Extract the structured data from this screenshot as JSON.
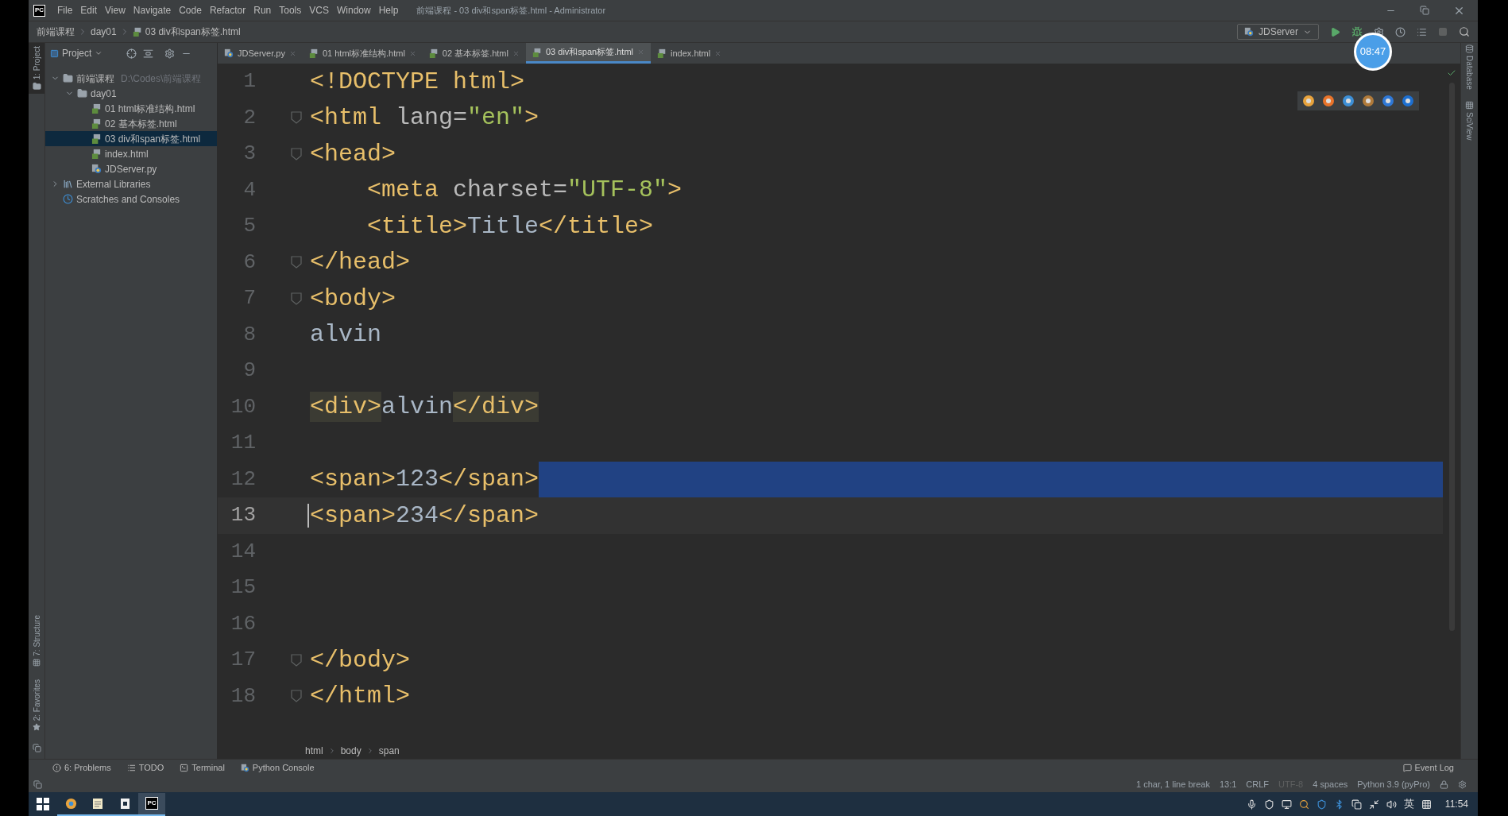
{
  "window": {
    "app_icon": "PC",
    "menu": [
      "File",
      "Edit",
      "View",
      "Navigate",
      "Code",
      "Refactor",
      "Run",
      "Tools",
      "VCS",
      "Window",
      "Help"
    ],
    "title": "前端课程 - 03 div和span标签.html - Administrator"
  },
  "breadcrumb": [
    "前端课程",
    "day01",
    "03 div和span标签.html"
  ],
  "run_config": {
    "label": "JDServer"
  },
  "timer_badge": "08:47",
  "left_strip": {
    "top": [
      "1: Project"
    ],
    "bottom": [
      "7: Structure",
      "2: Favorites"
    ]
  },
  "right_strip": [
    "Database",
    "SciView"
  ],
  "project_panel": {
    "title": "Project",
    "tree": [
      {
        "label": "前端课程",
        "path": "D:\\Codes\\前端课程",
        "kind": "folder",
        "expanded": true,
        "selected": false,
        "children": [
          {
            "label": "day01",
            "kind": "folder",
            "expanded": true,
            "selected": false,
            "children": [
              {
                "label": "01 html标准结构.html",
                "kind": "html",
                "selected": false
              },
              {
                "label": "02 基本标签.html",
                "kind": "html",
                "selected": false
              },
              {
                "label": "03 div和span标签.html",
                "kind": "html",
                "selected": true
              },
              {
                "label": "index.html",
                "kind": "html",
                "selected": false
              },
              {
                "label": "JDServer.py",
                "kind": "python",
                "selected": false
              }
            ]
          }
        ]
      },
      {
        "label": "External Libraries",
        "kind": "library",
        "expanded": false,
        "selected": false
      },
      {
        "label": "Scratches and Consoles",
        "kind": "scratches",
        "selected": false
      }
    ]
  },
  "tabs": [
    {
      "label": "JDServer.py",
      "kind": "python",
      "selected": false
    },
    {
      "label": "01 html标准结构.html",
      "kind": "html",
      "selected": false
    },
    {
      "label": "02 基本标签.html",
      "kind": "html",
      "selected": false
    },
    {
      "label": "03 div和span标签.html",
      "kind": "html",
      "selected": true
    },
    {
      "label": "index.html",
      "kind": "html",
      "selected": false
    }
  ],
  "editor": {
    "lines": [
      {
        "number": "1",
        "fold": false,
        "indented": false,
        "current": false,
        "selected": false,
        "tokens": [
          {
            "kind": "tag",
            "text": "<!DOCTYPE html>"
          }
        ]
      },
      {
        "number": "2",
        "fold": true,
        "indented": false,
        "current": false,
        "selected": false,
        "tokens": [
          {
            "kind": "tag",
            "text": "<html"
          },
          {
            "kind": "attr",
            "text": " lang="
          },
          {
            "kind": "value",
            "text": "\"en\""
          },
          {
            "kind": "tag",
            "text": ">"
          }
        ]
      },
      {
        "number": "3",
        "fold": true,
        "indented": false,
        "current": false,
        "selected": false,
        "tokens": [
          {
            "kind": "tag",
            "text": "<head>"
          }
        ]
      },
      {
        "number": "4",
        "fold": false,
        "indented": true,
        "current": false,
        "selected": false,
        "tokens": [
          {
            "kind": "tag",
            "text": "<meta"
          },
          {
            "kind": "attr",
            "text": " charset="
          },
          {
            "kind": "value",
            "text": "\"UTF-8\""
          },
          {
            "kind": "tag",
            "text": ">"
          }
        ]
      },
      {
        "number": "5",
        "fold": false,
        "indented": true,
        "current": false,
        "selected": false,
        "tokens": [
          {
            "kind": "tag",
            "text": "<title>"
          },
          {
            "kind": "text",
            "text": "Title"
          },
          {
            "kind": "tag",
            "text": "</title>"
          }
        ]
      },
      {
        "number": "6",
        "fold": true,
        "indented": false,
        "current": false,
        "selected": false,
        "tokens": [
          {
            "kind": "tag",
            "text": "</head>"
          }
        ]
      },
      {
        "number": "7",
        "fold": true,
        "indented": false,
        "current": false,
        "selected": false,
        "tokens": [
          {
            "kind": "tag",
            "text": "<body>"
          }
        ]
      },
      {
        "number": "8",
        "fold": false,
        "indented": false,
        "current": false,
        "selected": false,
        "tokens": [
          {
            "kind": "text",
            "text": "alvin"
          }
        ]
      },
      {
        "number": "9",
        "fold": false,
        "indented": false,
        "current": false,
        "selected": false
      },
      {
        "number": "10",
        "fold": false,
        "indented": false,
        "current": false,
        "selected": false,
        "tokens": [
          {
            "kind": "tag",
            "text": "<div>",
            "highlight": true
          },
          {
            "kind": "text",
            "text": "alvin",
            "highlight": false
          },
          {
            "kind": "tag",
            "text": "</div>",
            "highlight": true
          }
        ]
      },
      {
        "number": "11",
        "fold": false,
        "indented": false,
        "current": false,
        "selected": false
      },
      {
        "number": "12",
        "fold": false,
        "indented": false,
        "current": false,
        "selected": true,
        "tokens": [
          {
            "kind": "tag",
            "text": "<span>"
          },
          {
            "kind": "text",
            "text": "123"
          },
          {
            "kind": "tag",
            "text": "</span>"
          }
        ]
      },
      {
        "number": "13",
        "fold": false,
        "indented": false,
        "current": true,
        "selected": false,
        "tokens": [
          {
            "kind": "tag",
            "text": "<span>"
          },
          {
            "kind": "text",
            "text": "234"
          },
          {
            "kind": "tag",
            "text": "</span>"
          }
        ]
      },
      {
        "number": "14",
        "fold": false,
        "indented": false,
        "current": false,
        "selected": false
      },
      {
        "number": "15",
        "fold": false,
        "indented": false,
        "current": false,
        "selected": false
      },
      {
        "number": "16",
        "fold": false,
        "indented": false,
        "current": false,
        "selected": false
      },
      {
        "number": "17",
        "fold": true,
        "indented": false,
        "current": false,
        "selected": false,
        "tokens": [
          {
            "kind": "tag",
            "text": "</body>"
          }
        ]
      },
      {
        "number": "18",
        "fold": true,
        "indented": false,
        "current": false,
        "selected": false,
        "tokens": [
          {
            "kind": "tag",
            "text": "</html>"
          }
        ]
      }
    ],
    "breadcrumb": [
      "html",
      "body",
      "span"
    ]
  },
  "tool_windows": [
    {
      "label": "6: Problems",
      "kind": "problems"
    },
    {
      "label": "TODO",
      "kind": "todo"
    },
    {
      "label": "Terminal",
      "kind": "terminal"
    },
    {
      "label": "Python Console",
      "kind": "python"
    }
  ],
  "event_log": "Event Log",
  "status_bar": [
    {
      "text": "1 char, 1 line break",
      "disabled": false
    },
    {
      "text": "13:1",
      "disabled": false
    },
    {
      "text": "CRLF",
      "disabled": false
    },
    {
      "text": "UTF-8",
      "disabled": true
    },
    {
      "text": "4 spaces",
      "disabled": false
    },
    {
      "text": "Python 3.9 (pyPro)",
      "disabled": false
    }
  ],
  "taskbar": {
    "apps": [
      {
        "kind": "browser",
        "active": false
      },
      {
        "kind": "notepad",
        "active": false
      },
      {
        "kind": "editor",
        "active": false
      },
      {
        "kind": "pycharm",
        "label": "PC",
        "active": true
      }
    ],
    "ime": "英",
    "clock": "11:54"
  }
}
